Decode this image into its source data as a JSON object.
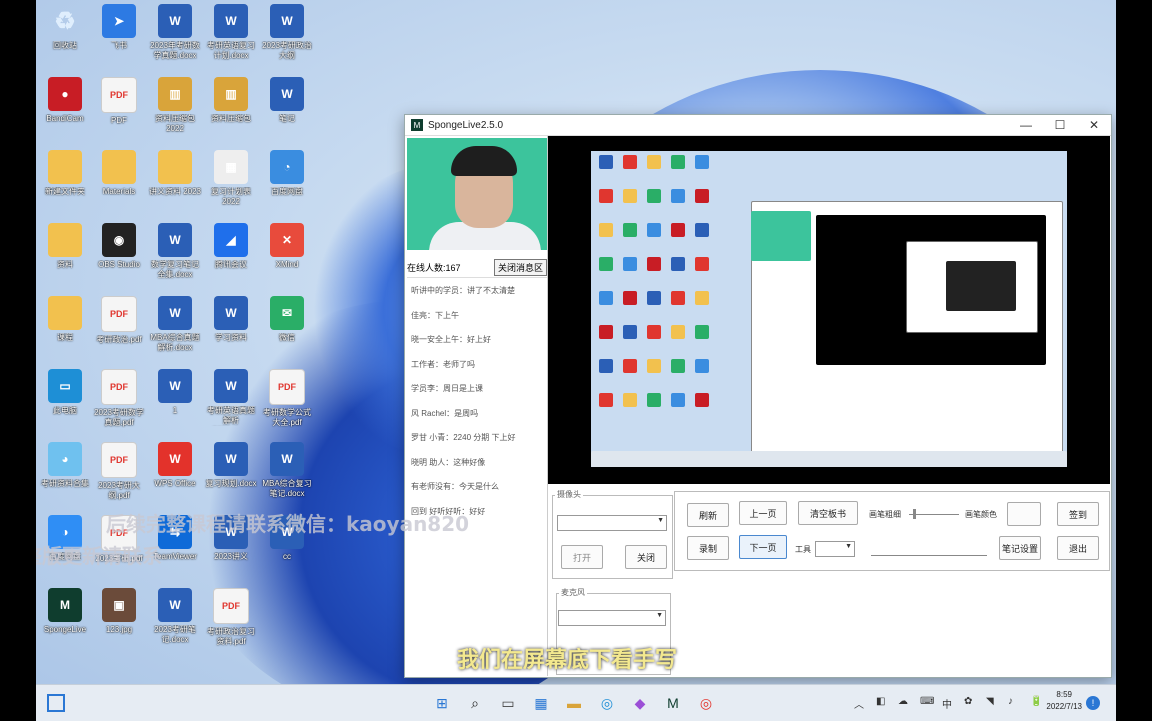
{
  "colors": {
    "accent": "#2b5fb6",
    "window_bg": "#ffffff",
    "subtitle": "#f3e88f",
    "desktop": "#c9dcf1",
    "taskbar": "#e6ecf3"
  },
  "desktop": {
    "icons": [
      {
        "label": "回收站",
        "type": "recycle",
        "glyph": "♻"
      },
      {
        "label": "飞书",
        "type": "app",
        "glyph": "➤",
        "color": "#2d7ae3"
      },
      {
        "label": "2023年考研数学真题.docx",
        "type": "word",
        "glyph": "W"
      },
      {
        "label": "考研英语复习计划.docx",
        "type": "word",
        "glyph": "W"
      },
      {
        "label": "2023考研政治大纲",
        "type": "word",
        "glyph": "W"
      },
      {
        "label": "BandiCam",
        "type": "app",
        "glyph": "●",
        "color": "#c81d25"
      },
      {
        "label": "PDF",
        "type": "pdf",
        "glyph": "PDF"
      },
      {
        "label": "资料压缩包 2022",
        "type": "app",
        "glyph": "▥",
        "color": "#d9a43a"
      },
      {
        "label": "资料压缩包",
        "type": "app",
        "glyph": "▥",
        "color": "#d9a43a"
      },
      {
        "label": "笔记",
        "type": "word",
        "glyph": "W"
      },
      {
        "label": "新建文件夹",
        "type": "folder",
        "glyph": ""
      },
      {
        "label": "Materials",
        "type": "folder",
        "glyph": ""
      },
      {
        "label": "讲义资料 2023",
        "type": "folder",
        "glyph": ""
      },
      {
        "label": "复习计划表 2022",
        "type": "app",
        "glyph": "▦",
        "color": "#eeeeee"
      },
      {
        "label": "百度网盘",
        "type": "app",
        "glyph": "◔",
        "color": "#3a8de0"
      },
      {
        "label": "资料",
        "type": "folder",
        "glyph": ""
      },
      {
        "label": "OBS Studio",
        "type": "app",
        "glyph": "◉",
        "color": "#222222"
      },
      {
        "label": "数学复习笔记全集.docx",
        "type": "word",
        "glyph": "W"
      },
      {
        "label": "腾讯会议",
        "type": "app",
        "glyph": "◢",
        "color": "#1f6feb"
      },
      {
        "label": "XMind",
        "type": "app",
        "glyph": "✕",
        "color": "#e84b3c"
      },
      {
        "label": "课程",
        "type": "folder",
        "glyph": ""
      },
      {
        "label": "考研政治.pdf",
        "type": "pdf",
        "glyph": "PDF"
      },
      {
        "label": "MBA综合真题解析.docx",
        "type": "word",
        "glyph": "W"
      },
      {
        "label": "学习资料",
        "type": "word",
        "glyph": "W"
      },
      {
        "label": "微信",
        "type": "app",
        "glyph": "✉",
        "color": "#2aae67"
      },
      {
        "label": "此电脑",
        "type": "app",
        "glyph": "▭",
        "color": "#1e8fd6"
      },
      {
        "label": "2023考研数学真题.pdf",
        "type": "pdf",
        "glyph": "PDF"
      },
      {
        "label": "1",
        "type": "word",
        "glyph": "W"
      },
      {
        "label": "考研英语真题解析 2023.docx",
        "type": "word",
        "glyph": "W"
      },
      {
        "label": "考研数学公式大全.pdf",
        "type": "pdf",
        "glyph": "PDF"
      },
      {
        "label": "考研资料合集",
        "type": "app",
        "glyph": "◕",
        "color": "#6fc1ef"
      },
      {
        "label": "2023考研大纲.pdf",
        "type": "pdf",
        "glyph": "PDF"
      },
      {
        "label": "WPS Office",
        "type": "app",
        "glyph": "W",
        "color": "#e3322b"
      },
      {
        "label": "复习规划.docx",
        "type": "word",
        "glyph": "W"
      },
      {
        "label": "MBA综合复习笔记.docx",
        "type": "word",
        "glyph": "W"
      },
      {
        "label": "百度网盘",
        "type": "app",
        "glyph": "◑",
        "color": "#2f8ef5"
      },
      {
        "label": "2023考研.pdf",
        "type": "pdf",
        "glyph": "PDF"
      },
      {
        "label": "TeamViewer",
        "type": "app",
        "glyph": "⇆",
        "color": "#0e6ad8"
      },
      {
        "label": "2023讲义",
        "type": "word",
        "glyph": "W"
      },
      {
        "label": "cc",
        "type": "word",
        "glyph": "W"
      },
      {
        "label": "SpongeLive",
        "type": "app",
        "glyph": "M",
        "color": "#0f3d2e"
      },
      {
        "label": "123.jpg",
        "type": "app",
        "glyph": "▣",
        "color": "#6b4b3a"
      },
      {
        "label": "2023考研笔记.docx",
        "type": "word",
        "glyph": "W"
      },
      {
        "label": "考研政治复习资料.pdf",
        "type": "pdf",
        "glyph": "PDF"
      }
    ]
  },
  "app_window": {
    "title": "SpongeLive2.5.0",
    "title_buttons": [
      "—",
      "☐",
      "✕"
    ],
    "online_count": "在线人数:167",
    "close_chat_btn": "关闭消息区",
    "chat_messages": [
      "听讲中的学员：讲了不太清楚",
      "佳亮：下上午",
      "晓一安全上午：好上好",
      "工作者：老师了吗",
      "学员李：周日是上课",
      "风 Rachel：是周吗",
      "罗甘 小青：2240 分期 下上好",
      "晓明 助人：这种好像",
      "有老师没有：今天是什么",
      "回到 好听好听：好好"
    ],
    "controls": {
      "camera_group_label": "摄像头",
      "open_btn": "打开",
      "close_btn": "关闭",
      "mic_group_label": "麦克风",
      "refresh_btn": "刷新",
      "record_btn": "录制",
      "prev_btn": "上一页",
      "next_btn": "下一页",
      "clear_board_btn": "清空板书",
      "pen_thickness_label": "画笔粗细",
      "pen_color_label": "画笔颜色",
      "tool_label": "工具",
      "sign_in_btn": "签到",
      "pen_settings_btn": "笔记设置",
      "exit_btn": "退出"
    }
  },
  "overlays": {
    "subtitle": "我们在屏幕底下看手写",
    "watermark_1": "后续完整课程请联系微信：kaoyan820",
    "watermark_2": "完整版更新请联系"
  },
  "taskbar": {
    "apps": [
      "⊞",
      "⌕",
      "▭",
      "▦",
      "▬",
      "◎",
      "◆",
      "M",
      "◎"
    ],
    "tray": [
      "︿",
      "◧",
      "☁",
      "⌨",
      "中",
      "✿",
      "◥",
      "♪",
      "🔋"
    ],
    "time": "8:59",
    "date": "2022/7/13"
  }
}
